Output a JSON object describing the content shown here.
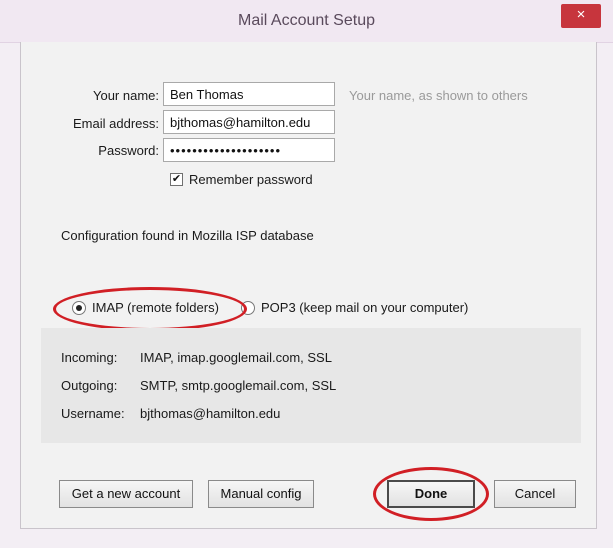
{
  "window": {
    "title": "Mail Account Setup",
    "close_glyph": "×"
  },
  "form": {
    "name_label": "Your name:",
    "name_value": "Ben Thomas",
    "name_hint": "Your name, as shown to others",
    "email_label": "Email address:",
    "email_value": "bjthomas@hamilton.edu",
    "password_label": "Password:",
    "password_value": "••••••••••••••••••••",
    "remember_label": "Remember password",
    "remember_checked": true
  },
  "status": {
    "text": "Configuration found in Mozilla ISP database"
  },
  "protocol": {
    "imap_label": "IMAP (remote folders)",
    "pop3_label": "POP3 (keep mail on your computer)",
    "selected": "IMAP"
  },
  "details": {
    "incoming_label": "Incoming:",
    "incoming_value": "IMAP, imap.googlemail.com, SSL",
    "outgoing_label": "Outgoing:",
    "outgoing_value": "SMTP, smtp.googlemail.com, SSL",
    "username_label": "Username:",
    "username_value": "bjthomas@hamilton.edu"
  },
  "buttons": {
    "new_account": "Get a new account",
    "manual_config": "Manual config",
    "done": "Done",
    "cancel": "Cancel"
  },
  "colors": {
    "highlight_ring": "#d11f25",
    "close_button": "#c7353d"
  }
}
